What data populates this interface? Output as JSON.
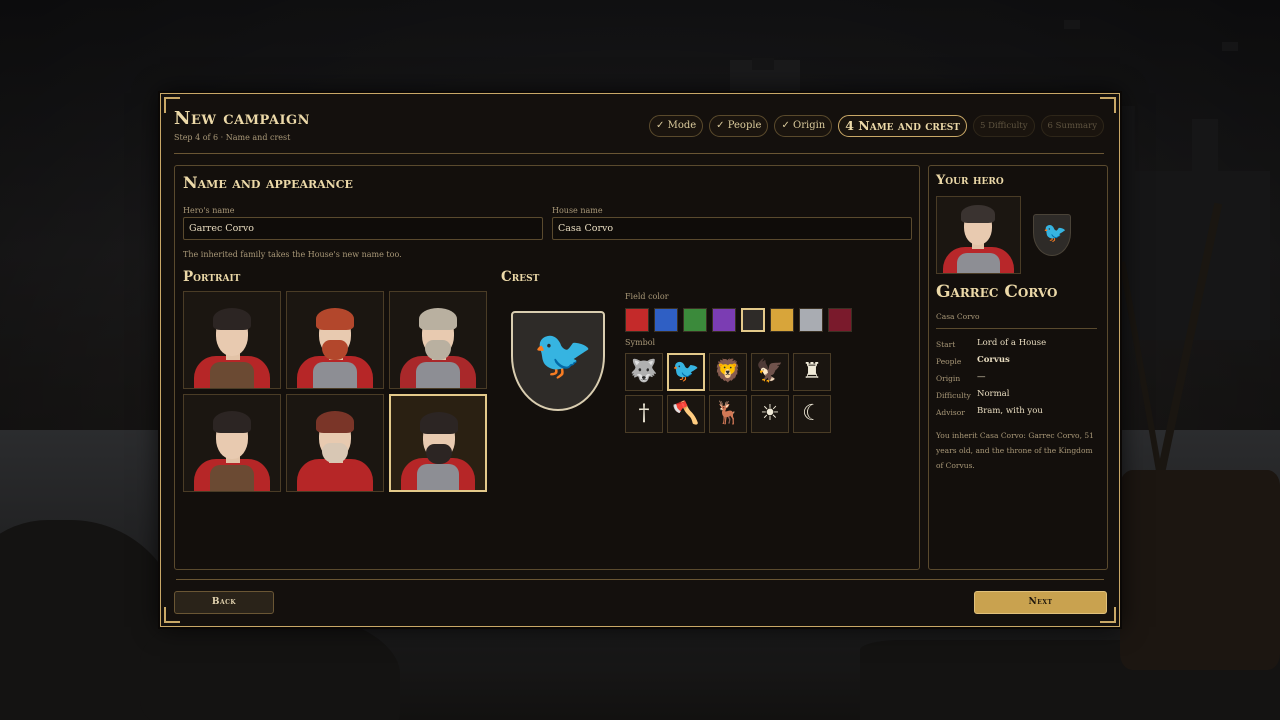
{
  "dialog": {
    "title": "New campaign",
    "subtitle": "Step 4 of 6 · Name and crest"
  },
  "steps": [
    {
      "label": "✓ Mode",
      "state": "done"
    },
    {
      "label": "✓ People",
      "state": "done"
    },
    {
      "label": "✓ Origin",
      "state": "done"
    },
    {
      "label": "4 Name and crest",
      "state": "current"
    },
    {
      "label": "5 Difficulty",
      "state": "todo"
    },
    {
      "label": "6 Summary",
      "state": "todo"
    }
  ],
  "main": {
    "title": "Name and appearance",
    "hero_name_label": "Hero's name",
    "hero_name_value": "Garrec Corvo",
    "house_name_label": "House name",
    "house_name_value": "Casa Corvo",
    "hint": "The inherited family takes the House's new name too.",
    "portrait_title": "Portrait",
    "crest_title": "Crest",
    "field_color_label": "Field color",
    "symbol_label": "Symbol"
  },
  "field_colors": [
    "#c42a2a",
    "#2f5fc4",
    "#3b8a3b",
    "#7b3db3",
    "#2e2b28",
    "#d8a53a",
    "#a9acb2",
    "#7a1a2c"
  ],
  "selected_color_index": 4,
  "symbols": [
    {
      "name": "wolf-icon",
      "glyph": "🐺"
    },
    {
      "name": "raven-icon",
      "glyph": "🐦"
    },
    {
      "name": "lion-icon",
      "glyph": "🦁"
    },
    {
      "name": "eagle-icon",
      "glyph": "🦅"
    },
    {
      "name": "tower-icon",
      "glyph": "♜"
    },
    {
      "name": "sword-icon",
      "glyph": "†"
    },
    {
      "name": "axe-icon",
      "glyph": "🪓"
    },
    {
      "name": "stag-icon",
      "glyph": "🦌"
    },
    {
      "name": "sun-icon",
      "glyph": "☀"
    },
    {
      "name": "moon-icon",
      "glyph": "☾"
    }
  ],
  "selected_symbol_index": 1,
  "portraits": [
    {
      "hair": "#2c2523",
      "beard": "",
      "body": "#b62627",
      "armor": "#6b4a33"
    },
    {
      "hair": "#b3472c",
      "beard": "#b3472c",
      "body": "#b62627",
      "armor": "#8d8e94"
    },
    {
      "hair": "#b9b0a0",
      "beard": "#b9b0a0",
      "body": "#a9282a",
      "armor": "#8d8e94"
    },
    {
      "hair": "#2c2523",
      "beard": "",
      "body": "#b62627",
      "armor": "#6b4a33"
    },
    {
      "hair": "#7a3528",
      "beard": "#d8c7b4",
      "body": "#b62627",
      "armor": "#b62627"
    },
    {
      "hair": "#2c2523",
      "beard": "#2c2523",
      "body": "#b62627",
      "armor": "#8d8e94"
    }
  ],
  "selected_portrait_index": 5,
  "hero": {
    "panel_title": "Your hero",
    "name": "Garrec Corvo",
    "house": "Casa Corvo",
    "rows": [
      {
        "key": "Start",
        "value": "Lord of a House",
        "strong": false
      },
      {
        "key": "People",
        "value": "Corvus",
        "strong": true
      },
      {
        "key": "Origin",
        "value": "—",
        "strong": false
      },
      {
        "key": "Difficulty",
        "value": "Normal",
        "strong": false
      },
      {
        "key": "Advisor",
        "value": "Bram, with you",
        "strong": false
      }
    ],
    "note": "You inherit Casa Corvo: Garrec Corvo, 51 years old, and the throne of the Kingdom of Corvus."
  },
  "buttons": {
    "back": "Back",
    "next": "Next"
  }
}
